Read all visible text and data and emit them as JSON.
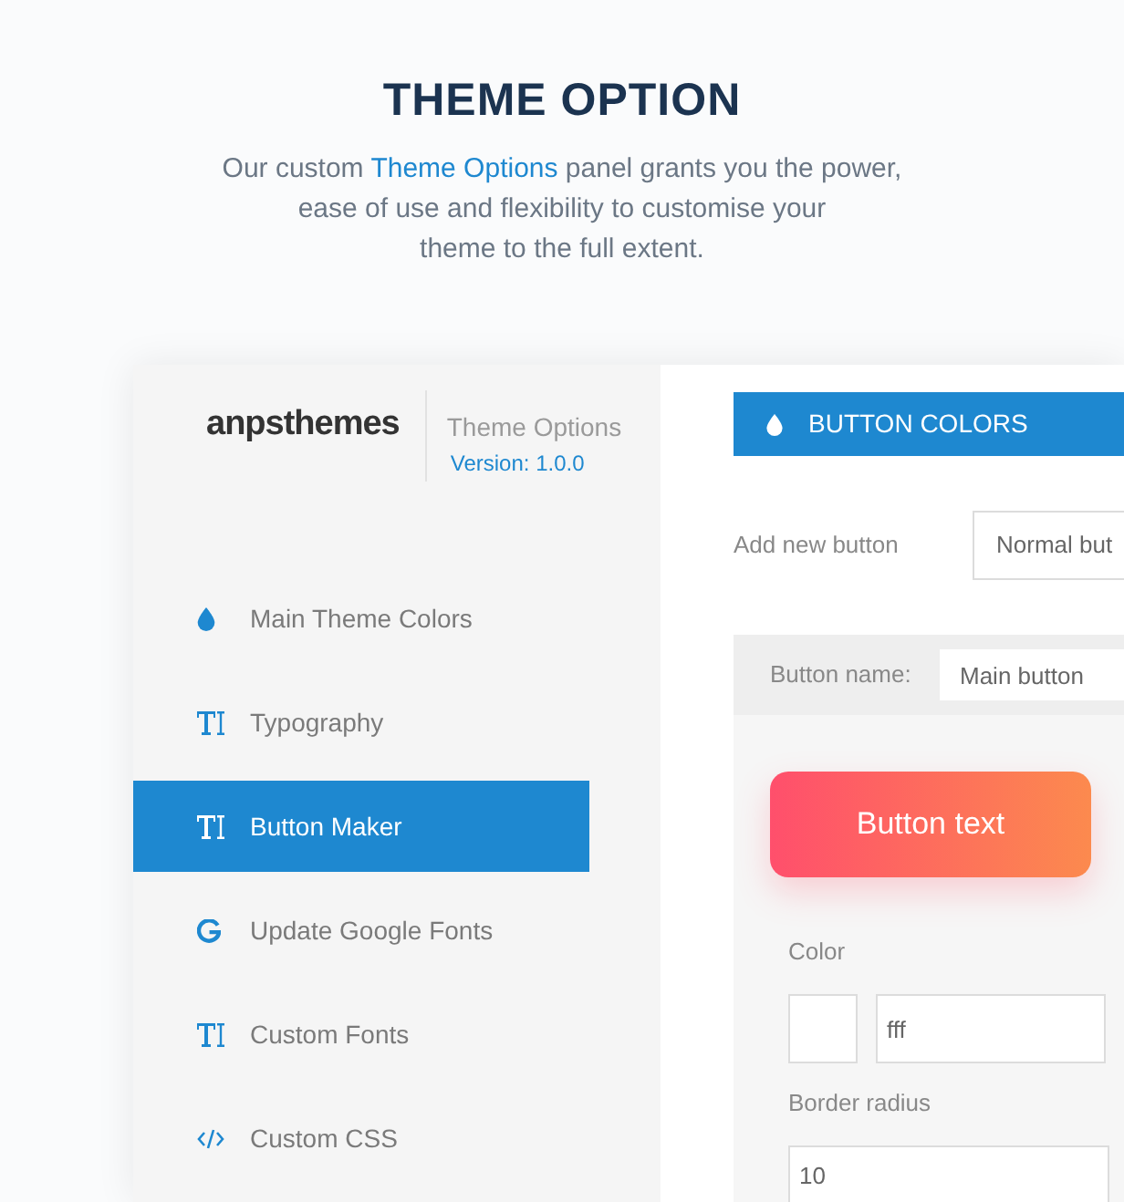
{
  "heading": {
    "title": "THEME OPTION",
    "intro": [
      {
        "before": "Our custom ",
        "link": "Theme Options",
        "after": " panel grants you the power,"
      },
      {
        "before": "ease of use and flexibility to customise your"
      },
      {
        "before": "theme to the full extent."
      }
    ]
  },
  "sidebar": {
    "logo": "anpsthemes",
    "product": "Theme Options",
    "version": "Version: 1.0.0",
    "items": [
      {
        "label": "Main Theme Colors",
        "selected": false
      },
      {
        "label": "Typography",
        "selected": false
      },
      {
        "label": "Button Maker",
        "selected": true
      },
      {
        "label": "Update Google Fonts",
        "selected": false
      },
      {
        "label": "Custom Fonts",
        "selected": false
      },
      {
        "label": "Custom CSS",
        "selected": false
      }
    ]
  },
  "content": {
    "section_title": "BUTTON COLORS",
    "add_button": {
      "label": "Add new button",
      "value": "Normal but"
    },
    "button_name": {
      "label": "Button name:",
      "value": "Main button"
    },
    "preview_button": {
      "label": "Button text"
    },
    "fields": [
      {
        "kind": "color",
        "label": "Color",
        "value": "fff"
      },
      {
        "kind": "text",
        "label": "Border radius",
        "value": "10"
      }
    ]
  }
}
